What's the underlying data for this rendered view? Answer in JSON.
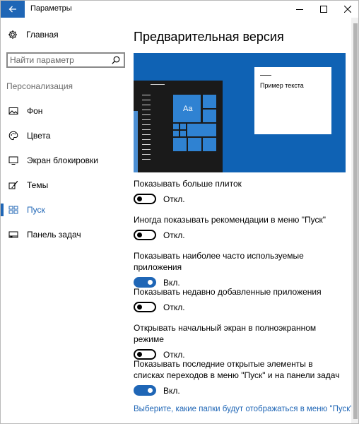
{
  "window": {
    "title": "Параметры"
  },
  "sidebar": {
    "home_label": "Главная",
    "search_placeholder": "Найти параметр",
    "section_title": "Персонализация",
    "items": [
      {
        "label": "Фон",
        "icon": "picture-icon",
        "active": false
      },
      {
        "label": "Цвета",
        "icon": "palette-icon",
        "active": false
      },
      {
        "label": "Экран блокировки",
        "icon": "lock-screen-icon",
        "active": false
      },
      {
        "label": "Темы",
        "icon": "brush-icon",
        "active": false
      },
      {
        "label": "Пуск",
        "icon": "start-icon",
        "active": true
      },
      {
        "label": "Панель задач",
        "icon": "taskbar-icon",
        "active": false
      }
    ]
  },
  "main": {
    "title": "Предварительная версия",
    "preview": {
      "tile_text": "Aa",
      "sample_text": "Пример текста"
    },
    "settings": [
      {
        "label": "Показывать больше плиток",
        "state": "Откл.",
        "on": false
      },
      {
        "label": "Иногда показывать рекомендации в меню \"Пуск\"",
        "state": "Откл.",
        "on": false
      },
      {
        "label": "Показывать наиболее часто используемые приложения",
        "state": "Вкл.",
        "on": true
      },
      {
        "label": "Показывать недавно добавленные приложения",
        "state": "Откл.",
        "on": false
      },
      {
        "label": "Открывать начальный экран в полноэкранном режиме",
        "state": "Откл.",
        "on": false
      },
      {
        "label": "Показывать последние открытые элементы в списках переходов в меню \"Пуск\" и на панели задач",
        "state": "Вкл.",
        "on": true
      }
    ],
    "link": "Выберите, какие папки будут отображаться в меню \"Пуск\""
  },
  "colors": {
    "accent": "#1f66b6",
    "preview_bg": "#0f62b4",
    "tile": "#2f82d2"
  }
}
